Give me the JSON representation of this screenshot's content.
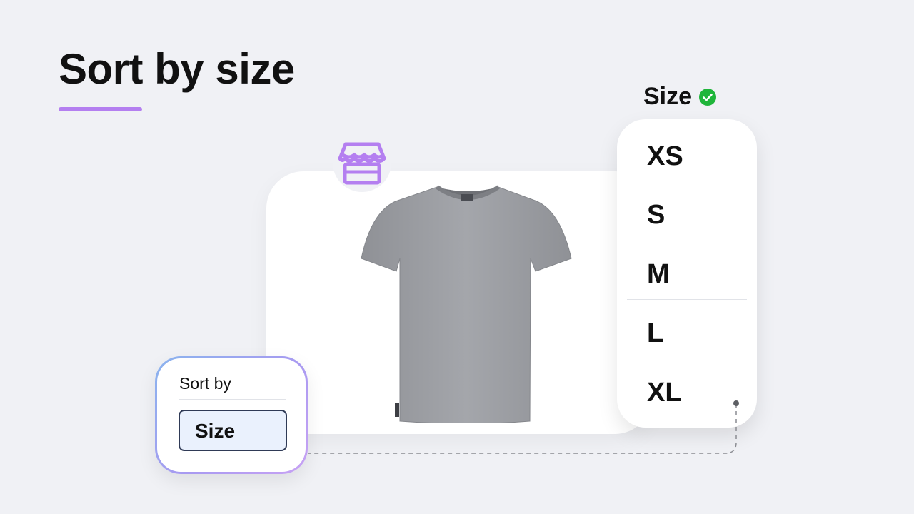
{
  "page": {
    "heading": "Sort by size"
  },
  "icons": {
    "store": "store-icon",
    "check": "check-circle-icon",
    "product": "tshirt-image"
  },
  "size_filter": {
    "label": "Size",
    "options": [
      "XS",
      "S",
      "M",
      "L",
      "XL"
    ]
  },
  "sort_control": {
    "title": "Sort by",
    "selected_value": "Size"
  },
  "colors": {
    "accent": "#b47ff0",
    "check": "#1fb53a",
    "tshirt": "#9b9da2",
    "select_border": "#2f3a56",
    "select_bg": "#eaf1fd"
  }
}
